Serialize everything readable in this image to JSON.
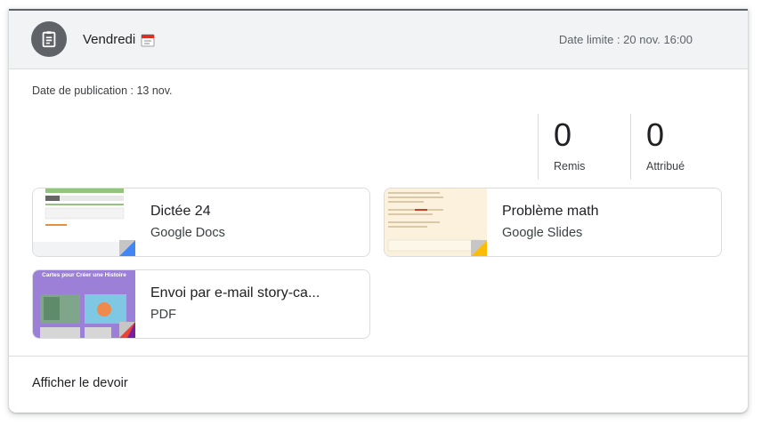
{
  "header": {
    "title": "Vendredi",
    "title_emoji": "calendar-emoji",
    "due": "Date limite : 20 nov. 16:00"
  },
  "posted": "Date de publication : 13 nov.",
  "stats": [
    {
      "value": "0",
      "label": "Remis"
    },
    {
      "value": "0",
      "label": "Attribué"
    }
  ],
  "attachments": [
    {
      "title": "Dictée 24",
      "type": "Google Docs",
      "color": "#4285f4"
    },
    {
      "title": "Problème math",
      "type": "Google Slides",
      "color": "#fbbc04"
    },
    {
      "title": "Envoi par e-mail story-ca...",
      "type": "PDF",
      "color": "#ea4335",
      "thumb_text": "Cartes pour Créer une Histoire"
    }
  ],
  "footer": {
    "view_label": "Afficher le devoir"
  }
}
